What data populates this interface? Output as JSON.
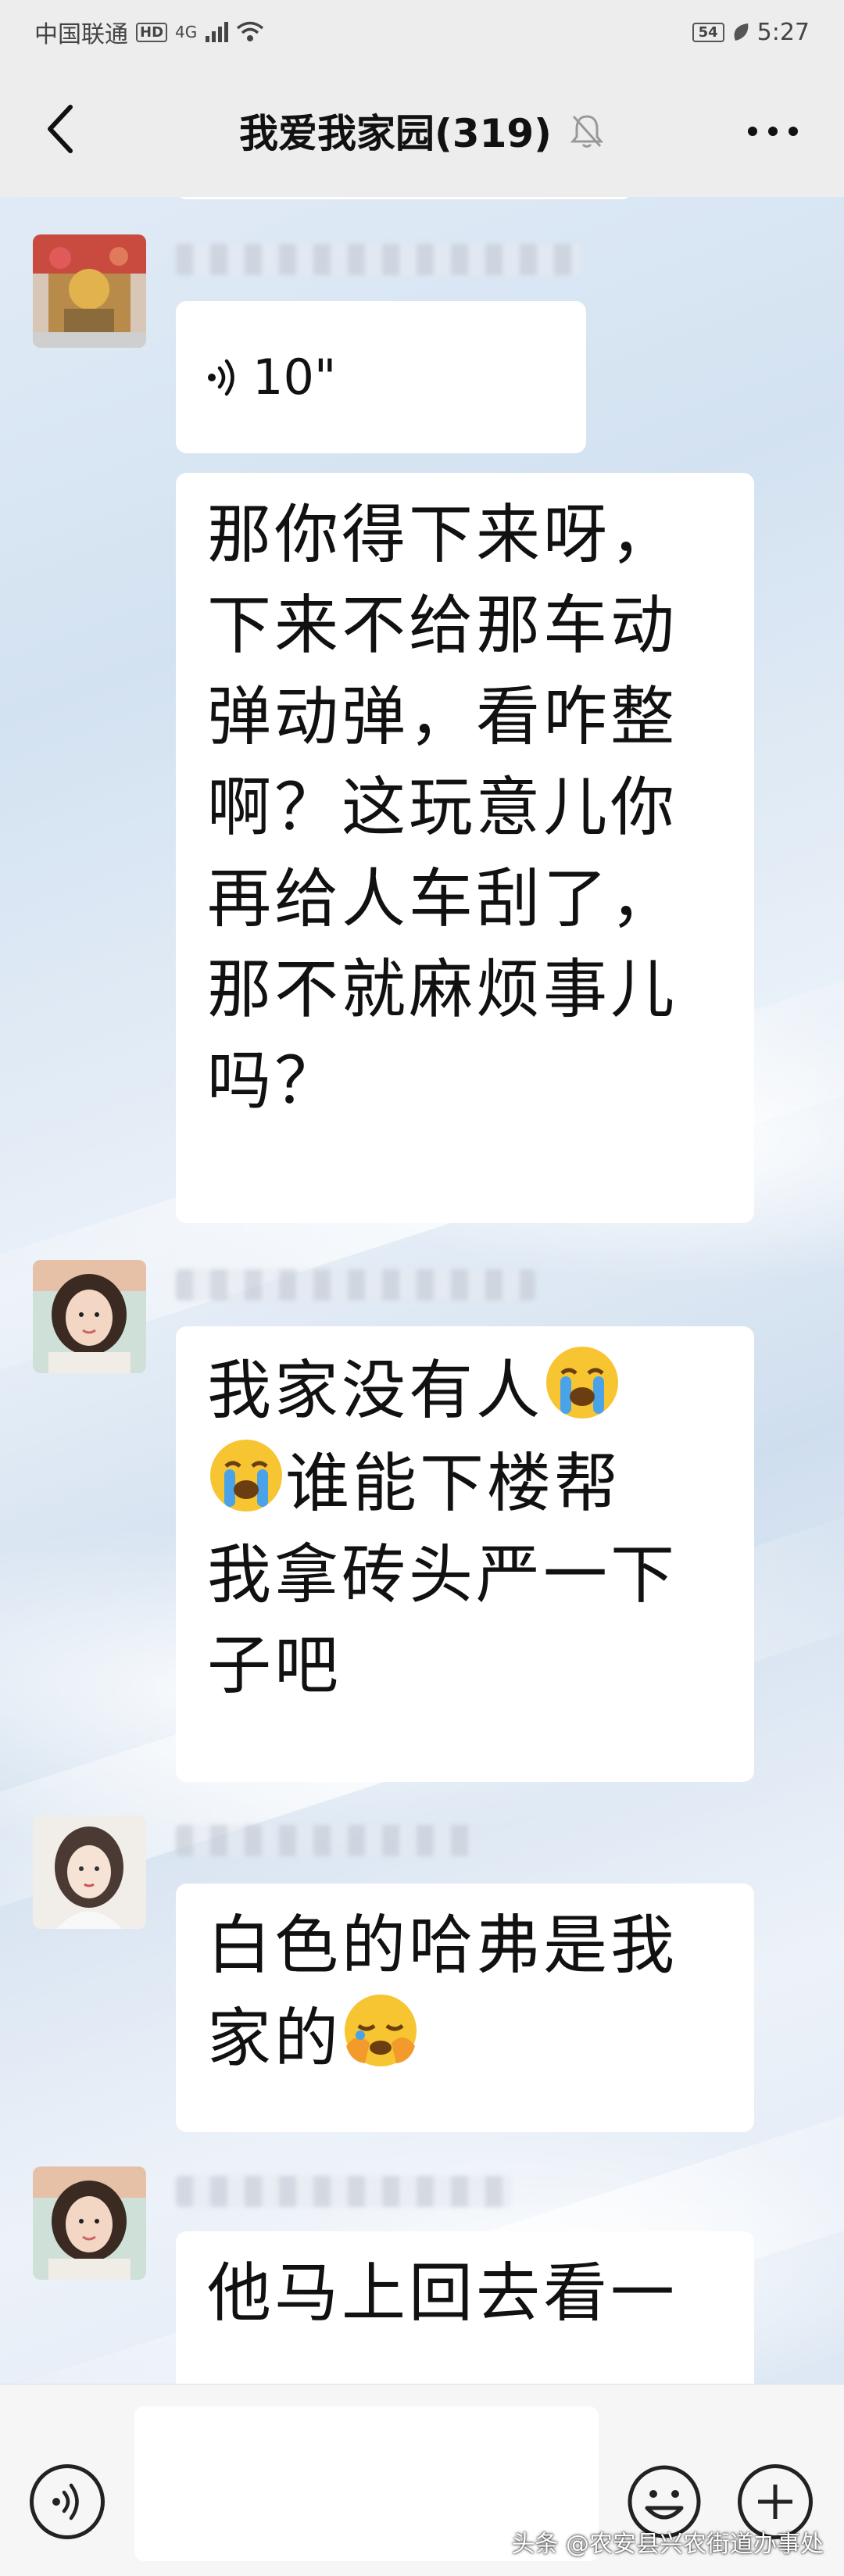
{
  "status_bar": {
    "carrier": "中国联通",
    "network_badge": "HD",
    "network_type": "4G",
    "battery": "54",
    "time": "5:27"
  },
  "header": {
    "title": "我爱我家园(319)",
    "back_icon": "chevron-left-icon",
    "muted_icon": "bell-muted-icon",
    "more_icon": "more-dots-icon"
  },
  "messages": [
    {
      "type": "voice",
      "duration": "10\""
    },
    {
      "type": "text",
      "text": "那你得下来呀，下来不给那车动弹动弹，看咋整啊？这玩意儿你再给人车刮了，那不就麻烦事儿吗？"
    },
    {
      "type": "text",
      "lines": [
        "我家没有人",
        "谁能下楼帮",
        "我拿砖头严一下",
        "子吧"
      ],
      "emojis": [
        "loudly-crying-face",
        "loudly-crying-face"
      ]
    },
    {
      "type": "text",
      "lines": [
        "白色的哈弗是我",
        "家的"
      ],
      "emojis": [
        "face-palm-crying"
      ]
    },
    {
      "type": "text",
      "text": "他马上回去看一"
    }
  ],
  "input_bar": {
    "voice_icon": "voice-icon",
    "emoji_icon": "smile-icon",
    "plus_icon": "plus-icon"
  },
  "watermark": "头条 @农安县兴农街道办事处",
  "colors": {
    "bar_bg": "#ededed",
    "bubble_bg": "#ffffff",
    "text": "#111111"
  }
}
